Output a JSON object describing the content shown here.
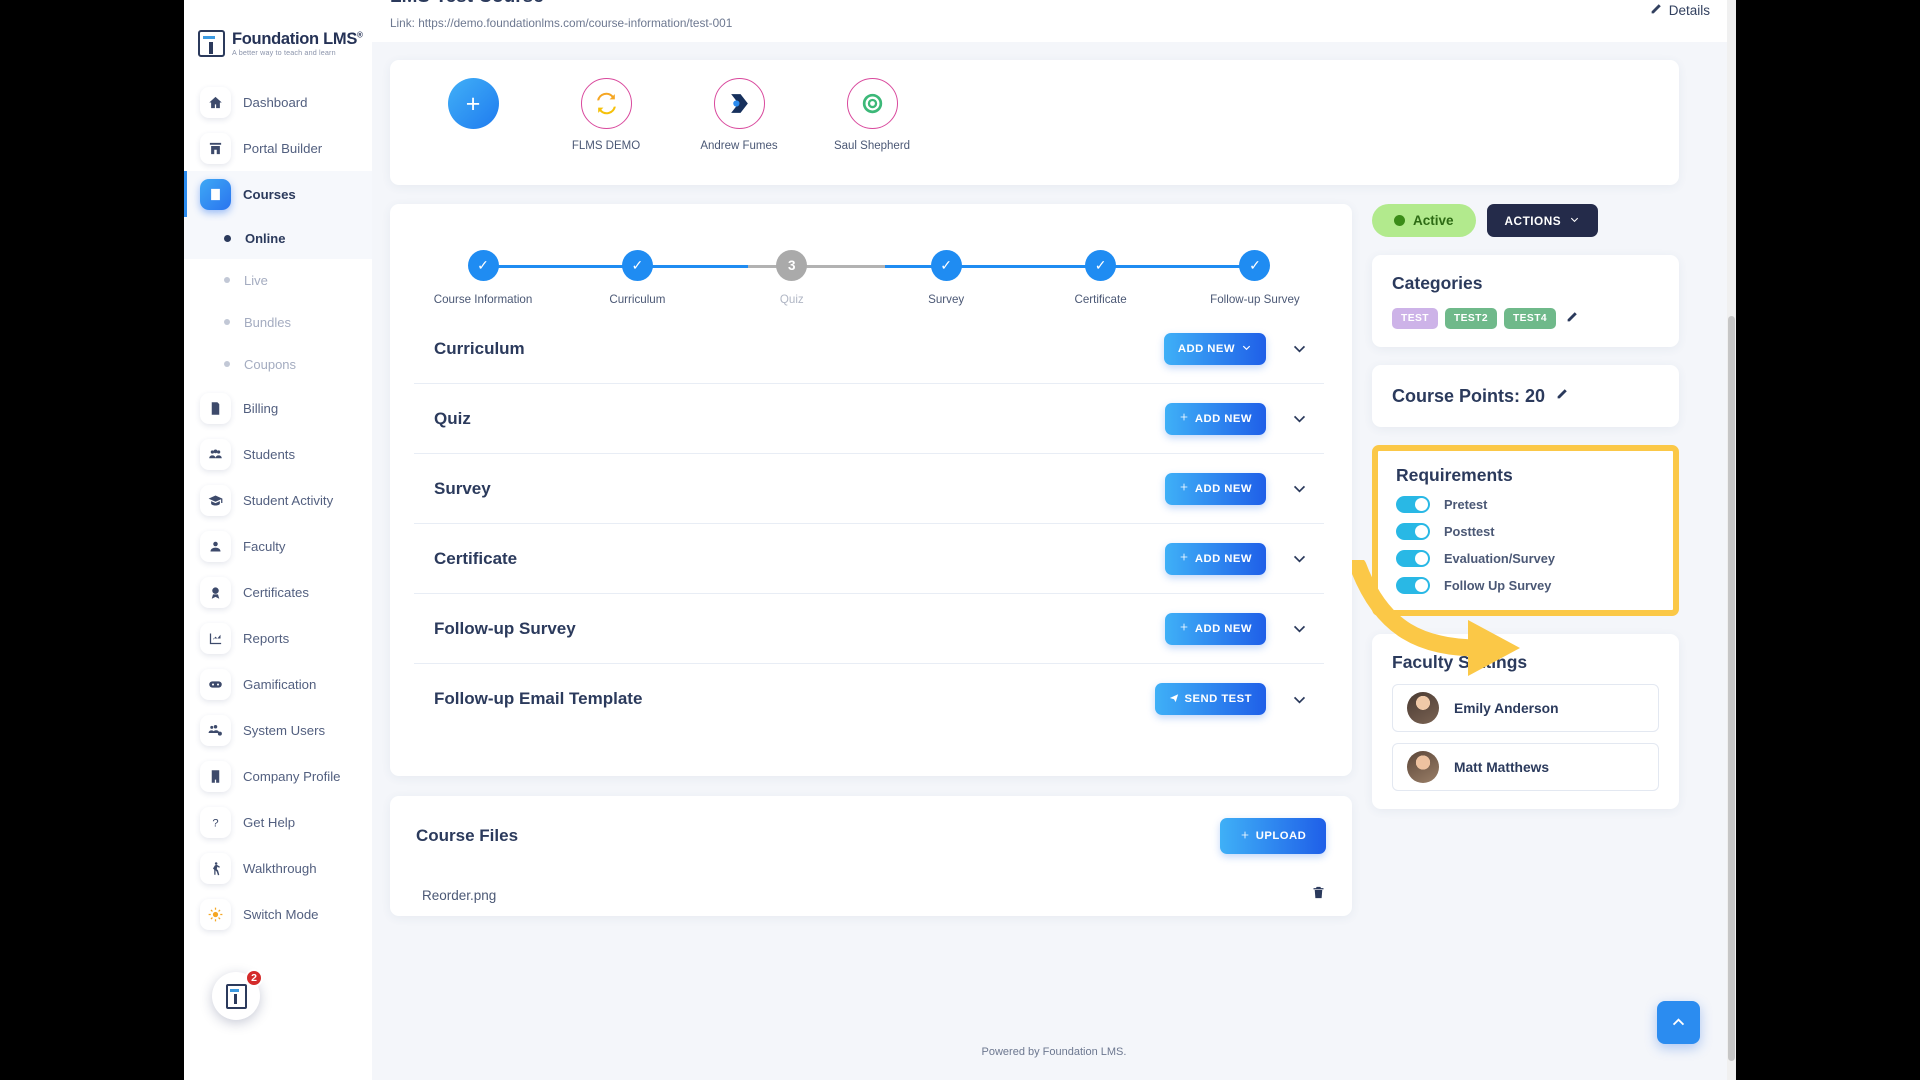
{
  "sidebar": {
    "logo": {
      "title": "Foundation LMS",
      "reg": "®",
      "tagline": "A better way to teach and learn"
    },
    "items": [
      {
        "label": "Dashboard",
        "icon": "home-icon",
        "active": false
      },
      {
        "label": "Portal Builder",
        "icon": "portal-icon",
        "active": false
      },
      {
        "label": "Courses",
        "icon": "book-icon",
        "active": true
      },
      {
        "label": "Billing",
        "icon": "invoice-icon",
        "active": false
      },
      {
        "label": "Students",
        "icon": "students-icon",
        "active": false
      },
      {
        "label": "Student Activity",
        "icon": "graduation-cap-icon",
        "active": false
      },
      {
        "label": "Faculty",
        "icon": "user-icon",
        "active": false
      },
      {
        "label": "Certificates",
        "icon": "award-icon",
        "active": false
      },
      {
        "label": "Reports",
        "icon": "chart-icon",
        "active": false
      },
      {
        "label": "Gamification",
        "icon": "gamepad-icon",
        "active": false
      },
      {
        "label": "System Users",
        "icon": "users-cog-icon",
        "active": false
      },
      {
        "label": "Company Profile",
        "icon": "building-icon",
        "active": false
      },
      {
        "label": "Get Help",
        "icon": "question-mark-icon",
        "active": false
      },
      {
        "label": "Walkthrough",
        "icon": "walking-icon",
        "active": false
      },
      {
        "label": "Switch Mode",
        "icon": "sun-icon",
        "active": false
      }
    ],
    "subitems": [
      {
        "label": "Online",
        "active": true
      },
      {
        "label": "Live",
        "active": false
      },
      {
        "label": "Bundles",
        "active": false
      },
      {
        "label": "Coupons",
        "active": false
      }
    ],
    "chat_badge": "2"
  },
  "header": {
    "title": "LMS Test Course",
    "link": "Link: https://demo.foundationlms.com/course-information/test-001",
    "details_label": "Details"
  },
  "people": {
    "add_label": "+",
    "items": [
      {
        "name": "FLMS DEMO",
        "type": "ring"
      },
      {
        "name": "Andrew Fumes",
        "type": "ring"
      },
      {
        "name": "Saul Shepherd",
        "type": "ring"
      }
    ]
  },
  "stepper": [
    {
      "label": "Course Information",
      "state": "done",
      "mark": "✓"
    },
    {
      "label": "Curriculum",
      "state": "done",
      "mark": "✓"
    },
    {
      "label": "Quiz",
      "state": "inactive",
      "mark": "3"
    },
    {
      "label": "Survey",
      "state": "done",
      "mark": "✓"
    },
    {
      "label": "Certificate",
      "state": "done",
      "mark": "✓"
    },
    {
      "label": "Follow-up Survey",
      "state": "done",
      "mark": "✓"
    }
  ],
  "accordion": [
    {
      "title": "Curriculum",
      "button": "ADD NEW",
      "button_style": "caret"
    },
    {
      "title": "Quiz",
      "button": "ADD NEW",
      "button_style": "plus"
    },
    {
      "title": "Survey",
      "button": "ADD NEW",
      "button_style": "plus"
    },
    {
      "title": "Certificate",
      "button": "ADD NEW",
      "button_style": "plus"
    },
    {
      "title": "Follow-up Survey",
      "button": "ADD NEW",
      "button_style": "plus"
    },
    {
      "title": "Follow-up Email Template",
      "button": "SEND TEST",
      "button_style": "send"
    }
  ],
  "files": {
    "title": "Course Files",
    "upload_label": "UPLOAD",
    "rows": [
      {
        "name": "Reorder.png"
      }
    ]
  },
  "right": {
    "status_label": "Active",
    "actions_label": "ACTIONS",
    "categories": {
      "title": "Categories",
      "tags": [
        {
          "label": "TEST",
          "color": "#cdb3e8"
        },
        {
          "label": "TEST2",
          "color": "#6fb98a"
        },
        {
          "label": "TEST4",
          "color": "#6fb98a"
        }
      ]
    },
    "points": {
      "label": "Course Points: 20"
    },
    "requirements": {
      "title": "Requirements",
      "items": [
        {
          "label": "Pretest",
          "on": true
        },
        {
          "label": "Posttest",
          "on": true
        },
        {
          "label": "Evaluation/Survey",
          "on": true
        },
        {
          "label": "Follow Up Survey",
          "on": true
        }
      ],
      "highlight_color": "#fbc847"
    },
    "faculty": {
      "title": "Faculty Settings",
      "members": [
        {
          "name": "Emily Anderson"
        },
        {
          "name": "Matt Matthews"
        }
      ]
    }
  },
  "footer": {
    "text": "Powered by Foundation LMS."
  }
}
